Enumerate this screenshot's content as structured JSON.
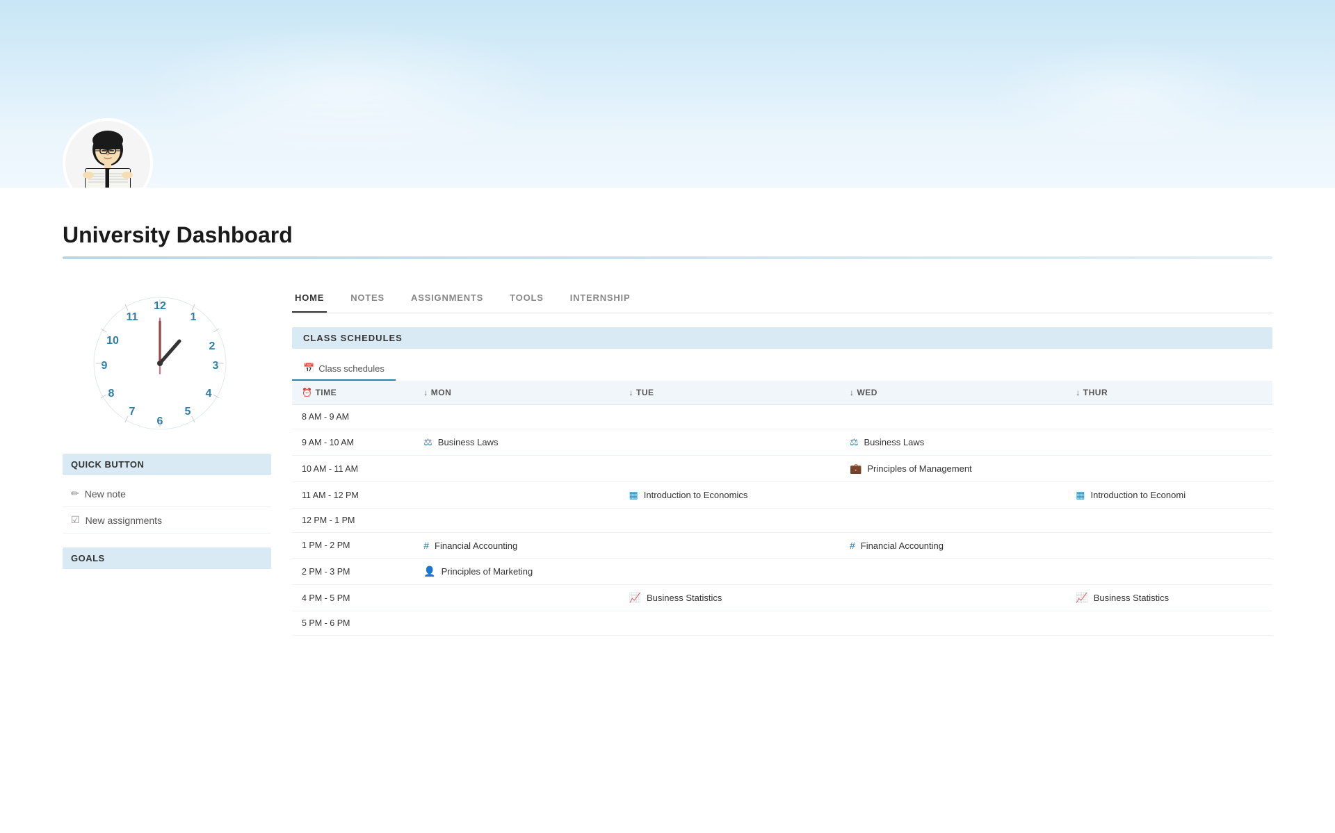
{
  "page": {
    "title": "University Dashboard"
  },
  "header": {
    "avatar_alt": "Student reading a book"
  },
  "tabs": [
    {
      "id": "home",
      "label": "HOME",
      "active": true
    },
    {
      "id": "notes",
      "label": "NOTES",
      "active": false
    },
    {
      "id": "assignments",
      "label": "ASSIGNMENTS",
      "active": false
    },
    {
      "id": "tools",
      "label": "TOOLS",
      "active": false
    },
    {
      "id": "internship",
      "label": "INTERNSHIP",
      "active": false
    }
  ],
  "sidebar": {
    "quick_button_header": "QUICK BUTTON",
    "buttons": [
      {
        "id": "new-note",
        "label": "New note",
        "icon": "✏️"
      },
      {
        "id": "new-assignments",
        "label": "New assignments",
        "icon": "☑️"
      }
    ],
    "goals_header": "GOALS"
  },
  "class_schedules": {
    "section_title": "CLASS SCHEDULES",
    "tab_label": "Class schedules",
    "tab_icon": "📅",
    "columns": [
      {
        "id": "time",
        "label": "TIME",
        "icon": "⏰"
      },
      {
        "id": "mon",
        "label": "MON",
        "icon": "↓"
      },
      {
        "id": "tue",
        "label": "TUE",
        "icon": "↓"
      },
      {
        "id": "wed",
        "label": "WED",
        "icon": "↓"
      },
      {
        "id": "thur",
        "label": "THUR",
        "icon": "↓"
      }
    ],
    "rows": [
      {
        "time": "8 AM - 9 AM",
        "mon": null,
        "tue": null,
        "wed": null,
        "thur": null
      },
      {
        "time": "9 AM - 10 AM",
        "mon": {
          "label": "Business Laws",
          "icon": "⚖️",
          "type": "law"
        },
        "tue": null,
        "wed": {
          "label": "Business Laws",
          "icon": "⚖️",
          "type": "law"
        },
        "thur": null
      },
      {
        "time": "10 AM - 11 AM",
        "mon": null,
        "tue": null,
        "wed": {
          "label": "Principles of Management",
          "icon": "💼",
          "type": "mgmt"
        },
        "thur": null
      },
      {
        "time": "11 AM - 12 PM",
        "mon": null,
        "tue": {
          "label": "Introduction to Economics",
          "icon": "📊",
          "type": "econ"
        },
        "wed": null,
        "thur": {
          "label": "Introduction to Economi",
          "icon": "📊",
          "type": "econ"
        }
      },
      {
        "time": "12 PM - 1 PM",
        "mon": null,
        "tue": null,
        "wed": null,
        "thur": null
      },
      {
        "time": "1 PM - 2 PM",
        "mon": {
          "label": "Financial Accounting",
          "icon": "#",
          "type": "finance"
        },
        "tue": null,
        "wed": {
          "label": "Financial Accounting",
          "icon": "#",
          "type": "finance"
        },
        "thur": null
      },
      {
        "time": "2 PM - 3 PM",
        "mon": {
          "label": "Principles of Marketing",
          "icon": "👤",
          "type": "marketing"
        },
        "tue": null,
        "wed": null,
        "thur": null
      },
      {
        "time": "4 PM - 5 PM",
        "mon": null,
        "tue": {
          "label": "Business Statistics",
          "icon": "📈",
          "type": "stats"
        },
        "wed": null,
        "thur": {
          "label": "Business Statistics",
          "icon": "📈",
          "type": "stats"
        }
      },
      {
        "time": "5 PM - 6 PM",
        "mon": null,
        "tue": null,
        "wed": null,
        "thur": null
      }
    ]
  }
}
